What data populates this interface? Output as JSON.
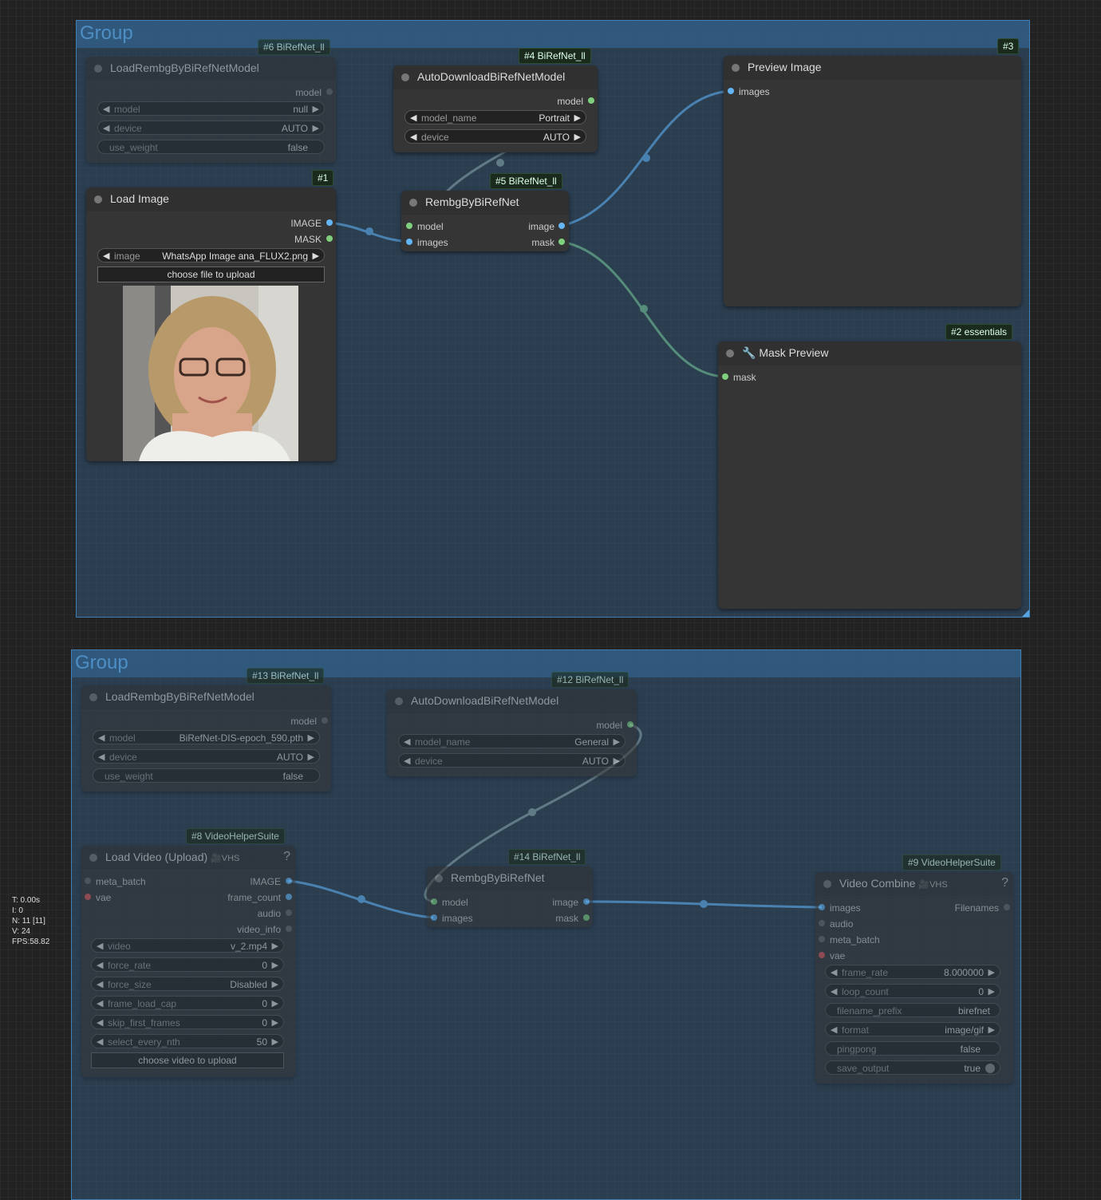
{
  "groups": [
    {
      "title": "Group"
    },
    {
      "title": "Group"
    }
  ],
  "nodes": {
    "n6": {
      "badge": "#6 BiRefNet_ll",
      "title": "LoadRembgByBiRefNetModel",
      "output": "model",
      "widgets": [
        {
          "label": "model",
          "value": "null"
        },
        {
          "label": "device",
          "value": "AUTO"
        },
        {
          "label": "use_weight",
          "value": "false"
        }
      ]
    },
    "n4": {
      "badge": "#4 BiRefNet_ll",
      "title": "AutoDownloadBiRefNetModel",
      "output": "model",
      "widgets": [
        {
          "label": "model_name",
          "value": "Portrait"
        },
        {
          "label": "device",
          "value": "AUTO"
        }
      ]
    },
    "n3": {
      "badge": "#3",
      "title": "Preview Image",
      "input": "images"
    },
    "n1": {
      "badge": "#1",
      "title": "Load Image",
      "outputs": [
        "IMAGE",
        "MASK"
      ],
      "widget": {
        "label": "image",
        "value": "WhatsApp Image ana_FLUX2.png"
      },
      "button": "choose file to upload"
    },
    "n5": {
      "badge": "#5 BiRefNet_ll",
      "title": "RembgByBiRefNet",
      "inputs": [
        "model",
        "images"
      ],
      "outputs": [
        "image",
        "mask"
      ]
    },
    "n2": {
      "badge": "#2 essentials",
      "title": "🔧 Mask Preview",
      "input": "mask"
    },
    "n13": {
      "badge": "#13 BiRefNet_ll",
      "title": "LoadRembgByBiRefNetModel",
      "output": "model",
      "widgets": [
        {
          "label": "model",
          "value": "BiRefNet-DIS-epoch_590.pth"
        },
        {
          "label": "device",
          "value": "AUTO"
        },
        {
          "label": "use_weight",
          "value": "false"
        }
      ]
    },
    "n12": {
      "badge": "#12 BiRefNet_ll",
      "title": "AutoDownloadBiRefNetModel",
      "output": "model",
      "widgets": [
        {
          "label": "model_name",
          "value": "General"
        },
        {
          "label": "device",
          "value": "AUTO"
        }
      ]
    },
    "n8": {
      "badge": "#8 VideoHelperSuite",
      "title": "Load Video (Upload)",
      "logo": "🎥VHS",
      "help": "?",
      "inputs": [
        "meta_batch",
        "vae"
      ],
      "outputs": [
        "IMAGE",
        "frame_count",
        "audio",
        "video_info"
      ],
      "widgets": [
        {
          "label": "video",
          "value": "v_2.mp4"
        },
        {
          "label": "force_rate",
          "value": "0"
        },
        {
          "label": "force_size",
          "value": "Disabled"
        },
        {
          "label": "frame_load_cap",
          "value": "0"
        },
        {
          "label": "skip_first_frames",
          "value": "0"
        },
        {
          "label": "select_every_nth",
          "value": "50"
        }
      ],
      "button": "choose video to upload"
    },
    "n14": {
      "badge": "#14 BiRefNet_ll",
      "title": "RembgByBiRefNet",
      "inputs": [
        "model",
        "images"
      ],
      "outputs": [
        "image",
        "mask"
      ]
    },
    "n9": {
      "badge": "#9 VideoHelperSuite",
      "title": "Video Combine",
      "logo": "🎥VHS",
      "help": "?",
      "inputs": [
        "images",
        "audio",
        "meta_batch",
        "vae"
      ],
      "output": "Filenames",
      "widgets": [
        {
          "label": "frame_rate",
          "value": "8.000000"
        },
        {
          "label": "loop_count",
          "value": "0"
        },
        {
          "label": "filename_prefix",
          "value": "birefnet"
        },
        {
          "label": "format",
          "value": "image/gif"
        },
        {
          "label": "pingpong",
          "value": "false"
        },
        {
          "label": "save_output",
          "value": "true"
        }
      ]
    }
  },
  "stats": [
    "T: 0.00s",
    "I: 0",
    "N: 11 [11]",
    "V: 24",
    "FPS:58.82"
  ],
  "colors": {
    "image_link": "#64b5f6",
    "mask_link": "#7ed07e",
    "model_link": "#9aa89a",
    "group_title": "#4d8fc4"
  }
}
